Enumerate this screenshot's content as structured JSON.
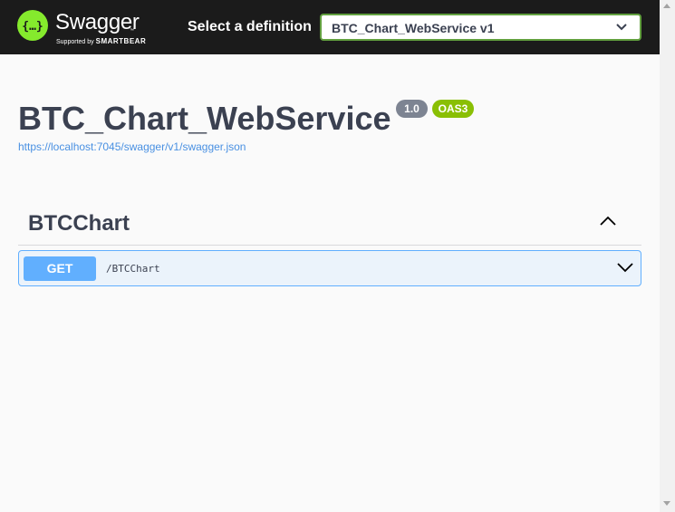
{
  "topbar": {
    "logo_icon": "swagger-logo-icon",
    "brand_name": "Swagger",
    "brand_tm": "™",
    "brand_sub_prefix": "Supported by",
    "brand_sub_company": "SMARTBEAR",
    "select_label": "Select a definition",
    "select_value": "BTC_Chart_WebService v1",
    "select_icon": "chevron-down-icon"
  },
  "info": {
    "title": "BTC_Chart_WebService",
    "version": "1.0",
    "oas_badge": "OAS3",
    "spec_url": "https://localhost:7045/swagger/v1/swagger.json"
  },
  "tag": {
    "name": "BTCChart",
    "toggle_icon": "chevron-up-icon"
  },
  "operations": [
    {
      "method": "GET",
      "path": "/BTCChart",
      "toggle_icon": "chevron-down-icon"
    }
  ],
  "colors": {
    "topbar_bg": "#1b1b1b",
    "brand_green": "#85ea2d",
    "get_blue": "#61affe",
    "get_bg": "#ebf3fb",
    "oas_green": "#89bf04",
    "version_grey": "#7d8492",
    "link_blue": "#4990e2",
    "text_dark": "#3b4151"
  }
}
